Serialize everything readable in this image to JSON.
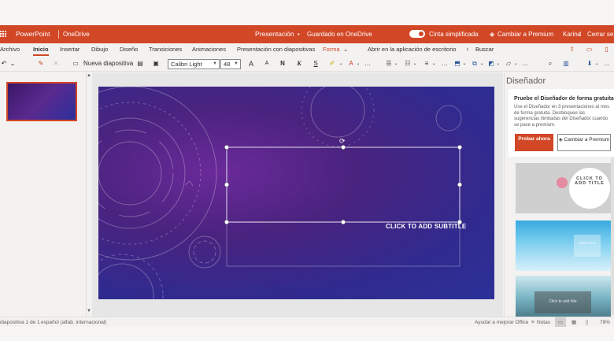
{
  "titlebar": {
    "app_name": "PowerPoint",
    "location": "OneDrive",
    "doc_title": "Presentación",
    "save_status": "Guardado en OneDrive",
    "simplified_ribbon_label": "Cinta simplificada",
    "upgrade_label": "Cambiar a Premium",
    "user_name": "Karina",
    "signout_label": "Cerrar sesi"
  },
  "tabs": {
    "items": [
      "Archivo",
      "Inicio",
      "Insertar",
      "Dibujo",
      "Diseño",
      "Transiciones",
      "Animaciones",
      "Presentación con diapositivas",
      "Forma"
    ],
    "open_desktop": "Abrir en la aplicación de escritorio",
    "search": "Buscar"
  },
  "ribbon": {
    "new_slide_label": "Nueva diapositiva",
    "font_name": "Calibri Light",
    "font_size": "48",
    "bold": "N",
    "italic": "K",
    "underline": "S",
    "grow_font": "A",
    "shrink_font": "A"
  },
  "slide": {
    "subtitle_placeholder": "CLICK TO ADD SUBTITLE"
  },
  "designer": {
    "title": "Diseñador",
    "promo_title": "Pruebe el Diseñador de forma gratuita",
    "promo_body": "Use el Diseñador en 3 presentaciones al mes de forma gratuita. Desbloquee las sugerencias ilimitadas del Diseñador cuando se pase a premium.",
    "try_button": "Probar ahora",
    "upgrade_button": "Cambiar a Premium",
    "thumb1_text": "CLICK TO ADD TITLE",
    "thumb2_text": "ADD TITLE",
    "thumb3_text": "Click to add title"
  },
  "statusbar": {
    "slide_counter": "diapositiva 1 de 1",
    "language": "español (alfab. internacional)",
    "help_improve": "Ayudar a mejorar Office",
    "notes": "Notas",
    "zoom": "78%"
  },
  "colors": {
    "accent": "#d24726",
    "slide_purple": "#4a237f",
    "slide_blue": "#2b3198"
  }
}
